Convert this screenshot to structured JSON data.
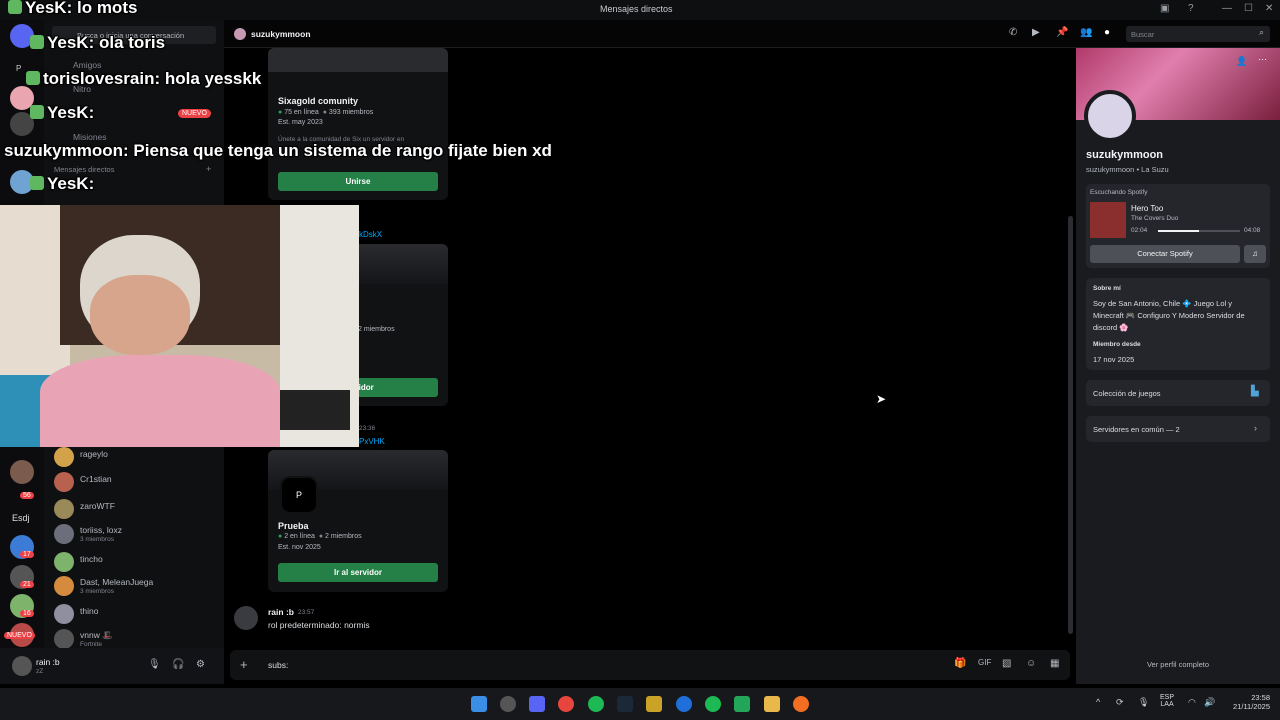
{
  "titlebar": {
    "title": "Mensajes directos",
    "chat_line_top": "lo mots"
  },
  "rail": {
    "badges": [
      "56",
      "17",
      "21",
      "16"
    ],
    "new_label": "NUEVO",
    "text_server": "Esdj",
    "p_label": "P"
  },
  "channels": {
    "search_placeholder": "Busca o inicia una conversación",
    "friends": "Amigos",
    "nitro": "Nitro",
    "tienda": "Tienda",
    "nuevo": "NUEVO",
    "misiones": "Misiones",
    "dm_header": "Mensajes directos",
    "dms": [
      {
        "name": "rageylo",
        "sub": ""
      },
      {
        "name": "Cr1stian",
        "sub": ""
      },
      {
        "name": "zaroWTF",
        "sub": ""
      },
      {
        "name": "toriiss, loxz",
        "sub": "3 miembros"
      },
      {
        "name": "tincho",
        "sub": ""
      },
      {
        "name": "Dast, MeleanJuega",
        "sub": "3 miembros"
      },
      {
        "name": "thino",
        "sub": ""
      },
      {
        "name": "vnnw 🎩",
        "sub": "Fortnite"
      }
    ],
    "top_dm": {
      "name": "suzukymmoon",
      "sub": "The Covers Duo"
    }
  },
  "user": {
    "name": "rain :b",
    "status": "zZ"
  },
  "chat": {
    "recipient": "suzukymmoon",
    "search_placeholder": "Buscar",
    "cards": [
      {
        "title": "Sixagold comunity",
        "online": "75 en línea",
        "members": "393 miembros",
        "est": "Est. may 2023",
        "desc": "Únete a la comunidad de Six un servidor en",
        "button": "Unirse"
      },
      {
        "title": "",
        "online": "",
        "members": "2 miembros",
        "est": "",
        "desc": "",
        "button": "servidor"
      },
      {
        "title": "Prueba",
        "online": "2 en línea",
        "members": "2 miembros",
        "est": "Est. nov 2025",
        "desc": "",
        "button": "Ir al servidor",
        "initial": "P"
      }
    ],
    "link1": "kDskX",
    "link2": "PxVHK",
    "time_mid": "23:36",
    "message": {
      "author": "rain :b",
      "time": "23:57",
      "text": "rol predeterminado: normis"
    },
    "input_value": "subs:"
  },
  "profile": {
    "display_name": "suzukymmoon",
    "username": "suzukymmoon",
    "pronoun_tag": "La Suzu",
    "spotify_header": "Escuchando Spotify",
    "song": "Hero Too",
    "artist": "The Covers Duo",
    "elapsed": "02:04",
    "duration": "04:08",
    "progress": 0.5,
    "connect_spotify": "Conectar Spotify",
    "about_header": "Sobre mí",
    "about_text": "Soy de San Antonio, Chile 💠 Juego Lol y Minecraft 🎮 Configuro Y Modero Servidor de discord 🌸",
    "member_since_header": "Miembro desde",
    "member_since": "17 nov 2025",
    "games": "Colección de juegos",
    "common_servers": "Servidores en común — 2",
    "view_full": "Ver perfil completo"
  },
  "overlay": {
    "lines": [
      {
        "user": "YesK:",
        "text": "lo mots"
      },
      {
        "user": "YesK:",
        "text": "ola toris"
      },
      {
        "user": "torislovesrain:",
        "text": "hola yesskk"
      },
      {
        "user": "YesK:",
        "text": ""
      },
      {
        "user": "suzukymmoon:",
        "text": "Piensa que tenga un sistema de rango fijate bien xd"
      },
      {
        "user": "YesK:",
        "text": ""
      }
    ]
  },
  "taskbar": {
    "lang": "ESP",
    "lang2": "LAA",
    "time": "23:58",
    "date": "21/11/2025"
  }
}
